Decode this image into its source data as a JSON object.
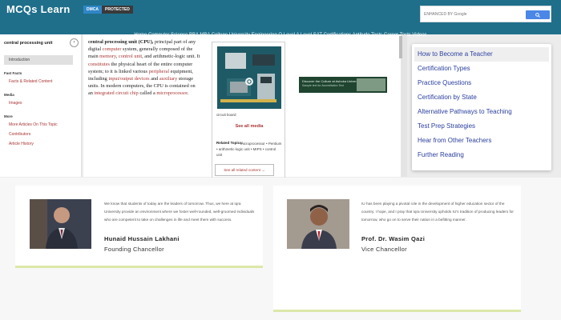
{
  "header": {
    "logo": "MCQs Learn",
    "dmca": "DMCA",
    "protected": "PROTECTED",
    "search_placeholder": "ENHANCED BY Google",
    "nav": "Home Computer Science BBA MBA College University Engineering O Level A Level SAT Certifications Aptitude Tests Career Tests Videos"
  },
  "sidebar": {
    "title": "central processing unit",
    "collapse": "‹",
    "active": "Introduction",
    "sections": [
      {
        "heading": "Fast Facts",
        "links": [
          "Facts & Related Content"
        ]
      },
      {
        "heading": "Media",
        "links": [
          "Images"
        ]
      },
      {
        "heading": "More",
        "links": [
          "More Articles On This Topic",
          "Contributors",
          "Article History"
        ]
      }
    ]
  },
  "article": {
    "p1": "central processing unit (CPU),",
    "p2": " principal part of any digital ",
    "computer": "computer",
    "p3": " system, generally composed of the main ",
    "memory": "memory",
    "p4": ", ",
    "control": "control unit",
    "p5": ", and arithmetic-logic unit. It ",
    "constitutes": "constitutes",
    "p6": " the physical heart of the entire computer system; to it is linked various ",
    "peripheral": "peripheral",
    "p7": " equipment, including ",
    "io": "input/output devices",
    "p8": " and ",
    "auxiliary": "auxiliary",
    "p9": " storage units. In modern computers, the CPU is contained on an ",
    "ic": "integrated circuit chip",
    "p10": " called a ",
    "micro": "microprocessor",
    "p11": "."
  },
  "infobox": {
    "caption": "circuit board",
    "see_all": "See all media",
    "related_heading": "Related Topics:",
    "related": "microprocessor • Pentium • arithmetic-logic unit • MIPS • control unit",
    "see_related": "See all related content →"
  },
  "banner": {
    "line1": "Discover the Culture at Ashoka University",
    "line2": "Sample text for Accreditation Text"
  },
  "dropdown": {
    "items": [
      "How to Become a Teacher",
      "Certification Types",
      "Practice Questions",
      "Certification by State",
      "Alternative Pathways to Teaching",
      "Test Prep Strategies",
      "Hear from Other Teachers",
      "Further Reading"
    ]
  },
  "cards": [
    {
      "quote": "We know that students of today are the leaders of tomorrow. Thus, we here at Iqra University provide an environment where we foster well-rounded, well-groomed individuals who are competent to take on challenges in life and meet them with success.",
      "name": "Hunaid Hussain Lakhani",
      "role": "Founding Chancellor"
    },
    {
      "quote": "IU has been playing a pivotal role in the development of higher education sector of the country. I hope, and I pray that Iqra University upholds IU's tradition of producing leaders for tomorrow, who go on to serve their nation in a befitting manner.",
      "name": "Prof. Dr. Wasim Qazi",
      "role": "Vice Chancellor"
    }
  ],
  "colors": {
    "header": "#1f6f8b",
    "link": "#aa3333",
    "dropdown_text": "#2b3f9f",
    "card_accent": "#dbe8a8"
  }
}
